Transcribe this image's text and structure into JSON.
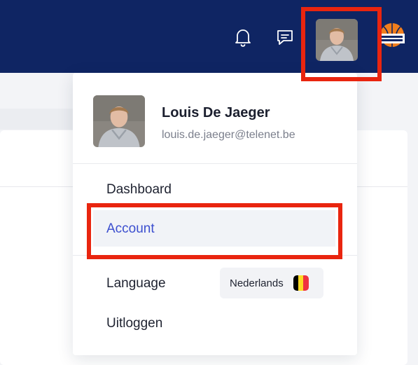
{
  "user": {
    "name": "Louis De Jaeger",
    "email": "louis.de.jaeger@telenet.be"
  },
  "menu": {
    "dashboard": "Dashboard",
    "account": "Account",
    "language": "Language",
    "logout": "Uitloggen"
  },
  "language_select": {
    "value": "Nederlands",
    "flag_colors": [
      "#000000",
      "#fdda24",
      "#ef3340"
    ]
  },
  "colors": {
    "topbar": "#0f2563",
    "highlight": "#e9250f",
    "accent": "#3c4fcf"
  },
  "icons": {
    "notifications": "bell-icon",
    "messages": "chat-icon",
    "brand": "basketball-belgium-logo"
  }
}
